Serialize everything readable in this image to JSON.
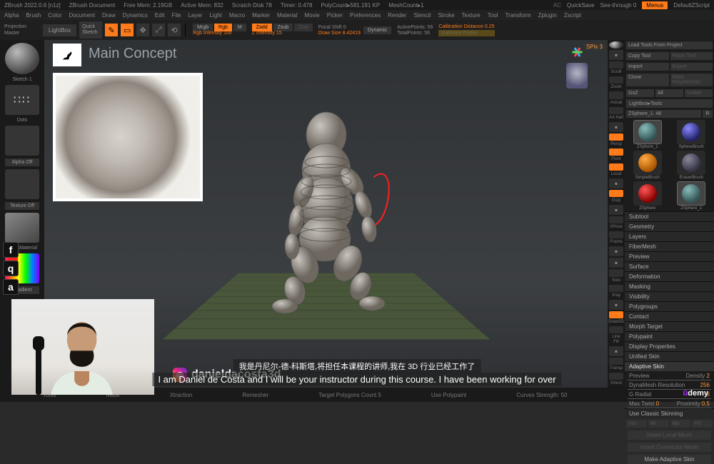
{
  "title": {
    "app": "ZBrush 2022.0.6 [n1z]",
    "doc": "ZBrush Document",
    "freemem": "Free Mem: 2.19GB",
    "activemem": "Active Mem: 832",
    "scratch": "Scratch Disk 78",
    "timer": "Timer: 0.478",
    "poly": "PolyCount▸581.191 KP",
    "mesh": "MeshCount▸1",
    "quicksave": "QuickSave",
    "seethrough": "See-through  0",
    "menus": "Menus",
    "script": "DefaultZScript"
  },
  "menubar": [
    "Alpha",
    "Brush",
    "Color",
    "Document",
    "Draw",
    "Dynamics",
    "Edit",
    "File",
    "Layer",
    "Light",
    "Macro",
    "Marker",
    "Material",
    "Movie",
    "Picker",
    "Preferences",
    "Render",
    "Stencil",
    "Stroke",
    "Texture",
    "Tool",
    "Transform",
    "Zplugin",
    "Zscript"
  ],
  "toolbar": {
    "proj1": "Projection",
    "proj2": "Master",
    "lightbox": "LightBox",
    "quick1": "Quick",
    "quick2": "Sketch",
    "mrgb": "Mrgb",
    "rgb": "Rgb",
    "m": "M",
    "rgbint": "Rgb Intensity 100",
    "zadd": "Zadd",
    "zsub": "Zsub",
    "zcut": "Zcut",
    "zint": "Z Intensity 15",
    "focal": "Focal Shift 0",
    "draw": "Draw Size 8.42419",
    "dynamic": "Dynamic",
    "active": "ActivePoints: 56",
    "total": "TotalPoints: 56",
    "calib": "Calibration Distance 0.25",
    "calprof": "Calibrate Profile"
  },
  "left": {
    "sketch": "Sketch 1",
    "dots": "Dots",
    "alpha": "Alpha Off",
    "texture": "Texture Off",
    "material": "BasicMaterial",
    "gradient": "Gradient"
  },
  "viewport": {
    "concept_title": "Main Concept",
    "instagram": "danieldacosta3d",
    "spix": "SPix  3"
  },
  "righttools": [
    "",
    "Scroll",
    "Zoom",
    "Actual",
    "AA Half",
    "",
    "Persp",
    "Floor",
    "Local",
    "",
    "Gizp",
    "",
    "XPose",
    "Frame",
    "",
    "",
    "Solo",
    "Xray",
    "",
    "Draw3D",
    "Line Fill",
    "",
    "Transp",
    "Ghost"
  ],
  "righttools_orange_idx": [
    6,
    7,
    8,
    10,
    19
  ],
  "rpanel": {
    "row1": [
      {
        "t": "Load Tools From Project",
        "dim": false
      }
    ],
    "row2": [
      {
        "t": "Copy Tool"
      },
      {
        "t": "Paste Tool",
        "dim": true
      }
    ],
    "row3": [
      {
        "t": "Import"
      },
      {
        "t": "Export",
        "dim": true
      }
    ],
    "row4": [
      {
        "t": "Clone"
      },
      {
        "t": "Make PolyMesh3D",
        "dim": true
      }
    ],
    "row5": [
      {
        "t": "GoZ"
      },
      {
        "t": "All"
      },
      {
        "t": "Visible",
        "dim": true
      }
    ],
    "breadcrumb": "Lightbox▸Tools",
    "toolname": "ZSphere_1. 46",
    "r": "R",
    "brushes": [
      {
        "name": "ZSphere_1",
        "color": "radial-gradient(circle at 35% 30%,#8bb,#355 70%)",
        "sel": true
      },
      {
        "name": "SphereBrush",
        "color": "radial-gradient(circle at 35% 30%,#88f,#226 70%)"
      },
      {
        "name": "SimpleBrush",
        "color": "radial-gradient(circle at 35% 30%,#fa4,#a50 70%)"
      },
      {
        "name": "EraserBrush",
        "color": "radial-gradient(circle at 35% 30%,#889,#334 70%)"
      },
      {
        "name": "ZSphere",
        "color": "radial-gradient(circle at 35% 30%,#f55,#800 70%)"
      },
      {
        "name": "ZSphere_1",
        "color": "radial-gradient(circle at 35% 30%,#8bb,#355 70%)",
        "sel": true
      }
    ],
    "sections": [
      "Subtool",
      "Geometry",
      "Layers",
      "FiberMesh",
      "Preview",
      "Surface",
      "Deformation",
      "Masking",
      "Visibility",
      "Polygroups",
      "Contact",
      "Morph Target",
      "Polypaint",
      "Display Properties",
      "Unified Skin"
    ],
    "adaptive": "Adaptive Skin",
    "preview": "Preview",
    "density_l": "Density",
    "density_v": "2",
    "dynares_l": "DynaMesh Resolution",
    "dynares_v": "256",
    "gradial_l": "G Radial",
    "gradial_v": "8",
    "maxtwist_l": "Max Twist",
    "maxtwist_v": "0",
    "proximity_l": "Proximity",
    "proximity_v": "0.5",
    "classic": "Use Classic Skinning",
    "ires": "Ires",
    "mc": "Mc",
    "mp": "Mp",
    "pd": "Pd",
    "insertlocal": "Insert Local Mesh",
    "insertconn": "Insert Connector Mesh",
    "makeadapt": "Make Adaptive Skin"
  },
  "bottom": [
    "Tools",
    "Mask",
    "Xtraction",
    "Remesher",
    "Target Polygons Count 5",
    "Use Polypaint",
    "Curves Strength: 50"
  ],
  "subtitles": {
    "zh": "我是丹尼尔-德-科斯塔,将担任本课程的讲师,我在 3D 行业已经工作了",
    "en": "I am Daniel de Costa and I will be your instructor during this course. I have been working for over"
  },
  "udemy": "ûdemy",
  "hotkeys": [
    "f",
    "q",
    "a"
  ]
}
